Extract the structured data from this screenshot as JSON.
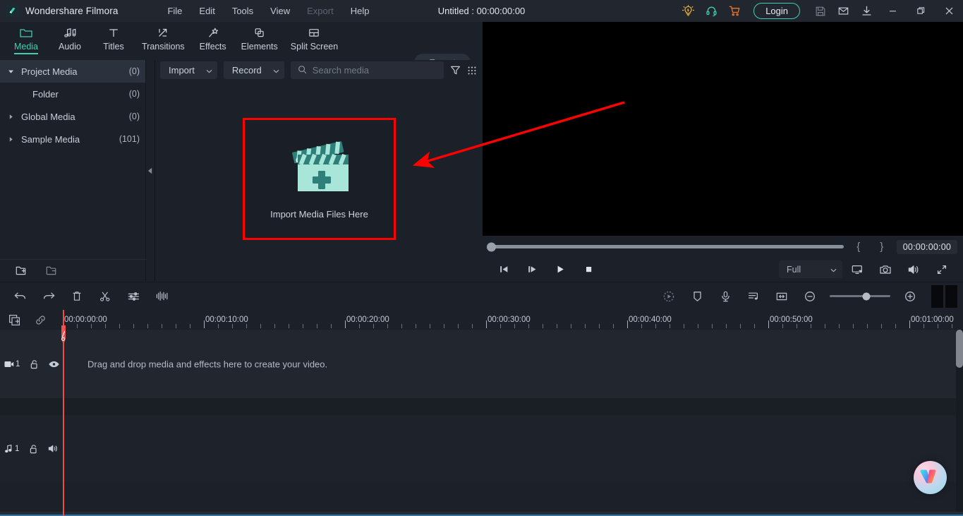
{
  "app": {
    "brand": "Wondershare Filmora",
    "document_title": "Untitled : 00:00:00:00",
    "accent_color": "#3fd0b0",
    "annotation_color": "#ff0000",
    "background_color": "#1c2029"
  },
  "menubar": {
    "items": [
      {
        "label": "File",
        "disabled": false
      },
      {
        "label": "Edit",
        "disabled": false
      },
      {
        "label": "Tools",
        "disabled": false
      },
      {
        "label": "View",
        "disabled": false
      },
      {
        "label": "Export",
        "disabled": true
      },
      {
        "label": "Help",
        "disabled": false
      }
    ]
  },
  "titlebar_actions": {
    "icons": [
      "lightbulb-icon",
      "headset-icon",
      "cart-icon"
    ],
    "login_label": "Login",
    "right_icons": [
      "save-icon",
      "mail-icon",
      "download-icon"
    ],
    "window_controls": [
      "minimize-icon",
      "maximize-icon",
      "close-icon"
    ]
  },
  "main_toolbar": {
    "items": [
      {
        "label": "Media",
        "icon": "folder-icon",
        "active": true
      },
      {
        "label": "Audio",
        "icon": "music-note-icon",
        "active": false
      },
      {
        "label": "Titles",
        "icon": "text-t-icon",
        "active": false
      },
      {
        "label": "Transitions",
        "icon": "transition-arrows-icon",
        "active": false
      },
      {
        "label": "Effects",
        "icon": "magic-wand-icon",
        "active": false
      },
      {
        "label": "Elements",
        "icon": "stacked-squares-icon",
        "active": false
      },
      {
        "label": "Split Screen",
        "icon": "split-screen-icon",
        "active": false
      }
    ],
    "export_label": "Export"
  },
  "sidebar": {
    "items": [
      {
        "label": "Project Media",
        "count": "(0)",
        "selected": true,
        "expanded": true,
        "child": false
      },
      {
        "label": "Folder",
        "count": "(0)",
        "selected": false,
        "expanded": null,
        "child": true
      },
      {
        "label": "Global Media",
        "count": "(0)",
        "selected": false,
        "expanded": false,
        "child": false
      },
      {
        "label": "Sample Media",
        "count": "(101)",
        "selected": false,
        "expanded": false,
        "child": false
      }
    ],
    "footer_icons": [
      "new-folder-icon",
      "remove-folder-icon"
    ]
  },
  "media_panel": {
    "import_label": "Import",
    "record_label": "Record",
    "search_placeholder": "Search media",
    "search_value": "",
    "filter_icon": "filter-funnel-icon",
    "grid_icon": "grid-view-icon",
    "dropzone_label": "Import Media Files Here"
  },
  "player": {
    "timecode": "00:00:00:00",
    "mark_in": "{",
    "mark_out": "}",
    "quality_label": "Full",
    "transport_icons": [
      "prev-frame-icon",
      "next-frame-icon",
      "play-icon",
      "stop-icon"
    ],
    "right_icons": [
      "display-icon",
      "snapshot-camera-icon",
      "volume-icon",
      "fullscreen-icon"
    ]
  },
  "timeline_toolbar": {
    "left_icons": [
      "undo-icon",
      "redo-icon",
      "delete-icon",
      "split-scissors-icon",
      "adjust-sliders-icon",
      "audio-waveform-icon"
    ],
    "right_icons": [
      "render-preview-icon",
      "marker-icon",
      "voiceover-mic-icon",
      "audio-mixer-icon",
      "fit-timeline-icon"
    ],
    "zoom_out_icon": "zoom-out-icon",
    "zoom_in_icon": "zoom-in-icon",
    "zoom_value": 60
  },
  "timeline": {
    "header_icons": [
      "add-track-icon",
      "link-media-icon"
    ],
    "ruler_labels": [
      "00:00:00:00",
      "00:00:10:00",
      "00:00:20:00",
      "00:00:30:00",
      "00:00:40:00",
      "00:00:50:00",
      "00:01:00:00"
    ],
    "playhead_time": "00:00:00:00",
    "video_track": {
      "number": "1",
      "lock_icon": "unlock-icon",
      "visibility_icon": "eye-icon"
    },
    "audio_track": {
      "number": "1",
      "lock_icon": "unlock-icon",
      "mute_icon": "speaker-icon"
    },
    "drop_hint": "Drag and drop media and effects here to create your video."
  },
  "assistant": {
    "icon": "wondershare-w-logo"
  }
}
